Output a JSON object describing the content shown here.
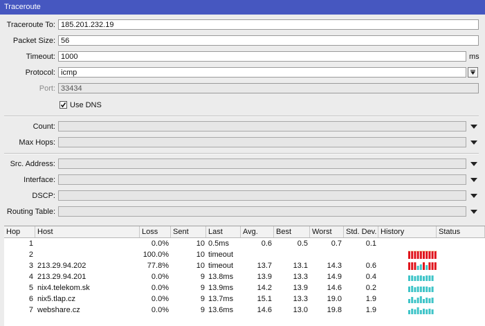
{
  "window": {
    "title": "Traceroute"
  },
  "form": {
    "traceroute_to": {
      "label": "Traceroute To:",
      "value": "185.201.232.19"
    },
    "packet_size": {
      "label": "Packet Size:",
      "value": "56"
    },
    "timeout": {
      "label": "Timeout:",
      "value": "1000",
      "unit": "ms"
    },
    "protocol": {
      "label": "Protocol:",
      "value": "icmp"
    },
    "port": {
      "label": "Port:",
      "value": "33434"
    },
    "use_dns": {
      "label": "Use DNS",
      "checked": true
    },
    "count": {
      "label": "Count:",
      "value": ""
    },
    "max_hops": {
      "label": "Max Hops:",
      "value": ""
    },
    "src_address": {
      "label": "Src. Address:",
      "value": ""
    },
    "interface": {
      "label": "Interface:",
      "value": ""
    },
    "dscp": {
      "label": "DSCP:",
      "value": ""
    },
    "routing_table": {
      "label": "Routing Table:",
      "value": ""
    }
  },
  "table": {
    "columns": [
      "Hop",
      "Host",
      "Loss",
      "Sent",
      "Last",
      "Avg.",
      "Best",
      "Worst",
      "Std. Dev.",
      "History",
      "Status"
    ],
    "rows": [
      {
        "hop": "1",
        "host": "",
        "loss": "0.0%",
        "sent": "10",
        "last": "0.5ms",
        "avg": "0.6",
        "best": "0.5",
        "worst": "0.7",
        "stddev": "0.1",
        "history": "none"
      },
      {
        "hop": "2",
        "host": "",
        "loss": "100.0%",
        "sent": "10",
        "last": "timeout",
        "avg": "",
        "best": "",
        "worst": "",
        "stddev": "",
        "history": "loss"
      },
      {
        "hop": "3",
        "host": "213.29.94.202",
        "loss": "77.8%",
        "sent": "10",
        "last": "timeout",
        "avg": "13.7",
        "best": "13.1",
        "worst": "14.3",
        "stddev": "0.6",
        "history": "mixed"
      },
      {
        "hop": "4",
        "host": "213.29.94.201",
        "loss": "0.0%",
        "sent": "9",
        "last": "13.8ms",
        "avg": "13.9",
        "best": "13.3",
        "worst": "14.9",
        "stddev": "0.4",
        "history": "ok"
      },
      {
        "hop": "5",
        "host": "nix4.telekom.sk",
        "loss": "0.0%",
        "sent": "9",
        "last": "13.9ms",
        "avg": "14.2",
        "best": "13.9",
        "worst": "14.6",
        "stddev": "0.2",
        "history": "ok"
      },
      {
        "hop": "6",
        "host": "nix5.tlap.cz",
        "loss": "0.0%",
        "sent": "9",
        "last": "13.7ms",
        "avg": "15.1",
        "best": "13.3",
        "worst": "19.0",
        "stddev": "1.9",
        "history": "ok"
      },
      {
        "hop": "7",
        "host": "webshare.cz",
        "loss": "0.0%",
        "sent": "9",
        "last": "13.6ms",
        "avg": "14.6",
        "best": "13.0",
        "worst": "19.8",
        "stddev": "1.9",
        "history": "ok"
      }
    ]
  },
  "colors": {
    "titlebar": "#4657c0",
    "history_ok": "#3fc4c8",
    "history_loss": "#e0141c"
  }
}
